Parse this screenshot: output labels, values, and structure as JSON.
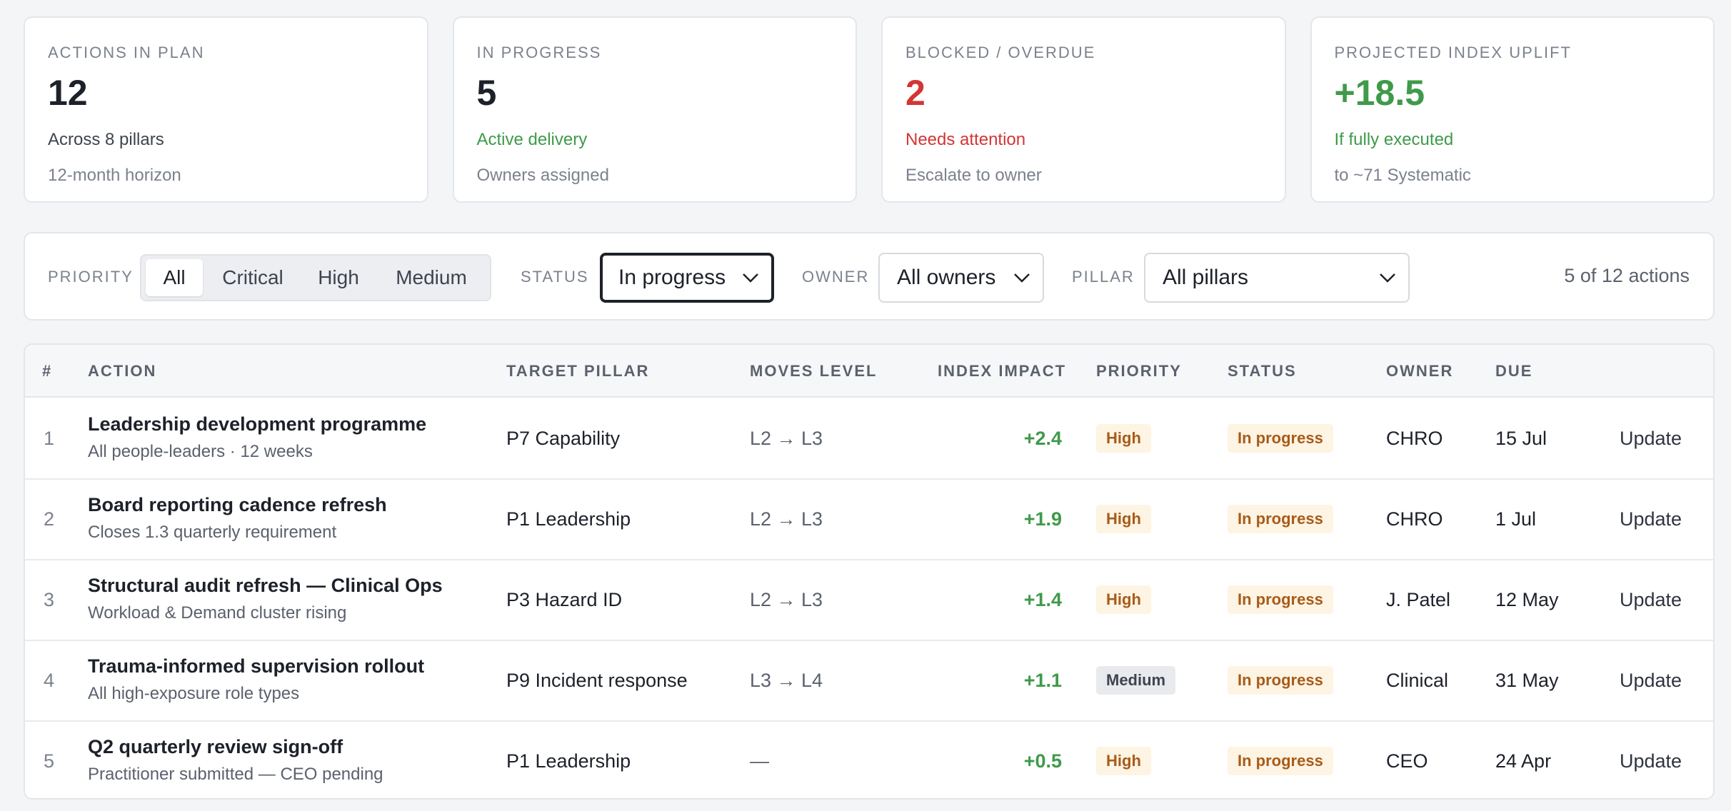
{
  "kpis": [
    {
      "label": "ACTIONS IN PLAN",
      "value": "12",
      "sub": "Across 8 pillars",
      "sub2": "12-month horizon"
    },
    {
      "label": "IN PROGRESS",
      "value": "5",
      "sub": "Active delivery",
      "sub2": "Owners assigned"
    },
    {
      "label": "BLOCKED / OVERDUE",
      "value": "2",
      "sub": "Needs attention",
      "sub2": "Escalate to owner"
    },
    {
      "label": "PROJECTED INDEX UPLIFT",
      "value": "+18.5",
      "sub": "If fully executed",
      "sub2": "to ~71 Systematic"
    }
  ],
  "filters": {
    "priority_label": "PRIORITY",
    "priority_options": [
      "All",
      "Critical",
      "High",
      "Medium"
    ],
    "priority_selected": "All",
    "status_label": "STATUS",
    "status_value": "In progress",
    "owner_label": "OWNER",
    "owner_value": "All owners",
    "pillar_label": "PILLAR",
    "pillar_value": "All pillars",
    "count_text": "5 of 12 actions"
  },
  "table": {
    "headers": [
      "#",
      "ACTION",
      "TARGET PILLAR",
      "MOVES LEVEL",
      "INDEX IMPACT",
      "PRIORITY",
      "STATUS",
      "OWNER",
      "DUE"
    ],
    "rows": [
      {
        "n": "1",
        "title": "Leadership development programme",
        "sub": "All people-leaders · 12 weeks",
        "pillar": "P7 Capability",
        "level": "L2 → L3",
        "impact": "+2.4",
        "priority": "High",
        "status": "In progress",
        "owner": "CHRO",
        "due": "15 Jul",
        "action": "Update"
      },
      {
        "n": "2",
        "title": "Board reporting cadence refresh",
        "sub": "Closes 1.3 quarterly requirement",
        "pillar": "P1 Leadership",
        "level": "L2 → L3",
        "impact": "+1.9",
        "priority": "High",
        "status": "In progress",
        "owner": "CHRO",
        "due": "1 Jul",
        "action": "Update"
      },
      {
        "n": "3",
        "title": "Structural audit refresh — Clinical Ops",
        "sub": "Workload & Demand cluster rising",
        "pillar": "P3 Hazard ID",
        "level": "L2 → L3",
        "impact": "+1.4",
        "priority": "High",
        "status": "In progress",
        "owner": "J. Patel",
        "due": "12 May",
        "action": "Update"
      },
      {
        "n": "4",
        "title": "Trauma-informed supervision rollout",
        "sub": "All high-exposure role types",
        "pillar": "P9 Incident response",
        "level": "L3 → L4",
        "impact": "+1.1",
        "priority": "Medium",
        "status": "In progress",
        "owner": "Clinical",
        "due": "31 May",
        "action": "Update"
      },
      {
        "n": "5",
        "title": "Q2 quarterly review sign-off",
        "sub": "Practitioner submitted — CEO pending",
        "pillar": "P1 Leadership",
        "level": "—",
        "impact": "+0.5",
        "priority": "High",
        "status": "In progress",
        "owner": "CEO",
        "due": "24 Apr",
        "action": "Update"
      }
    ]
  },
  "colors": {
    "positive": "#3f9a4a",
    "negative": "#d33535",
    "badge_warm_bg": "#fdf4e4",
    "badge_warm_text": "#a85b18"
  },
  "icons": {
    "select_arrow": "chevron-down-icon"
  }
}
